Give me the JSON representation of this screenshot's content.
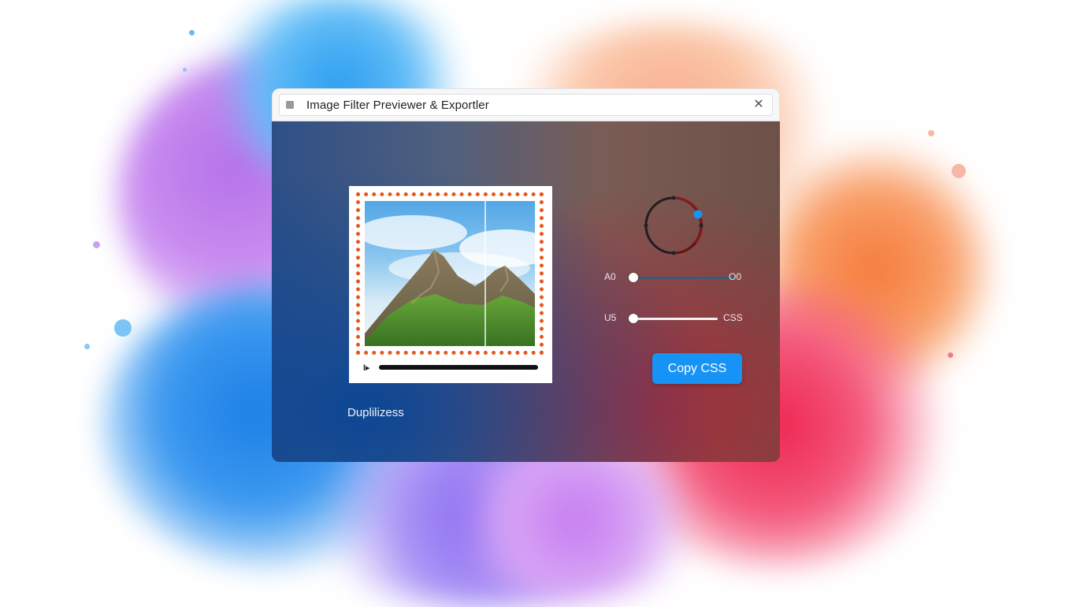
{
  "window": {
    "title": "Image Filter Previewer & Exportler",
    "close_icon_glyph": "✕"
  },
  "preview": {
    "play_icon_glyph": "I▸",
    "frame_color": "#e8561b"
  },
  "controls": {
    "slider1": {
      "left_label": "A0",
      "right_label": "O0",
      "value": 0.0
    },
    "slider2": {
      "left_label": "U5",
      "right_label": "CSS",
      "value": 0.0
    },
    "copy_button_label": "Copy CSS"
  },
  "footer": {
    "label": "Duplilizess"
  },
  "colors": {
    "accent": "#1793f5",
    "dial_knob": "#1793f5"
  }
}
